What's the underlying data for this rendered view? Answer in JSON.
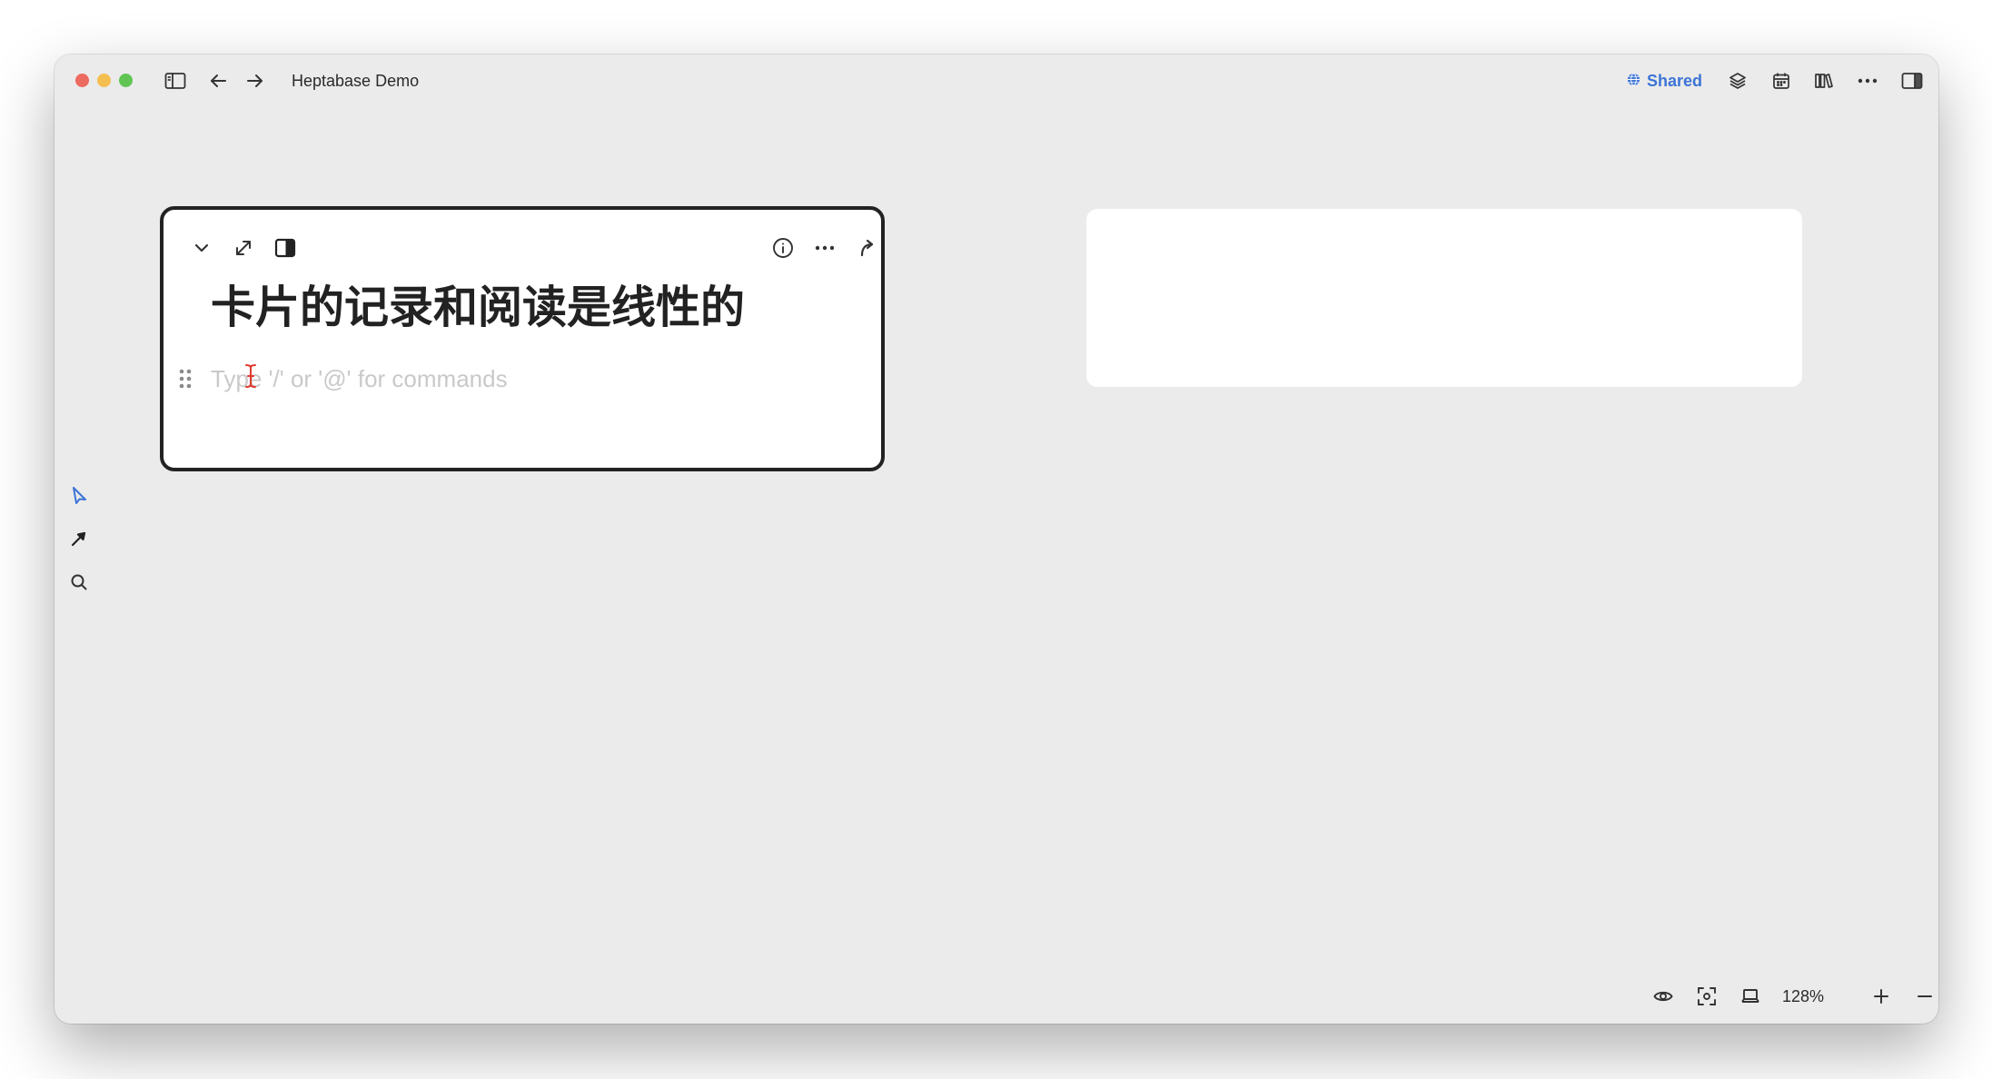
{
  "window": {
    "title": "Heptabase Demo",
    "shared_label": "Shared"
  },
  "toolbar_left": {
    "icons": [
      "sidebar-toggle-icon",
      "back-arrow-icon",
      "forward-arrow-icon"
    ]
  },
  "toolbar_right": {
    "icons": [
      "globe-icon",
      "layers-icon",
      "calendar-icon",
      "library-icon",
      "more-icon",
      "right-panel-icon"
    ]
  },
  "card": {
    "title": "卡片的记录和阅读是线性的",
    "placeholder": "Type '/' or '@' for commands",
    "toolbar_icons": [
      "collapse-chevron-icon",
      "expand-icon",
      "side-panel-icon",
      "info-icon",
      "more-icon",
      "open-redirect-icon"
    ]
  },
  "left_tools": [
    "select-cursor-icon",
    "arrow-connector-icon",
    "search-icon"
  ],
  "bottom_bar": {
    "zoom": "128%",
    "icons": [
      "eye-icon",
      "focus-frame-icon",
      "laptop-icon",
      "plus-icon",
      "minus-icon"
    ]
  },
  "colors": {
    "accent": "#3b74d6",
    "canvas_bg": "#ebebeb",
    "card_border": "#222222"
  }
}
